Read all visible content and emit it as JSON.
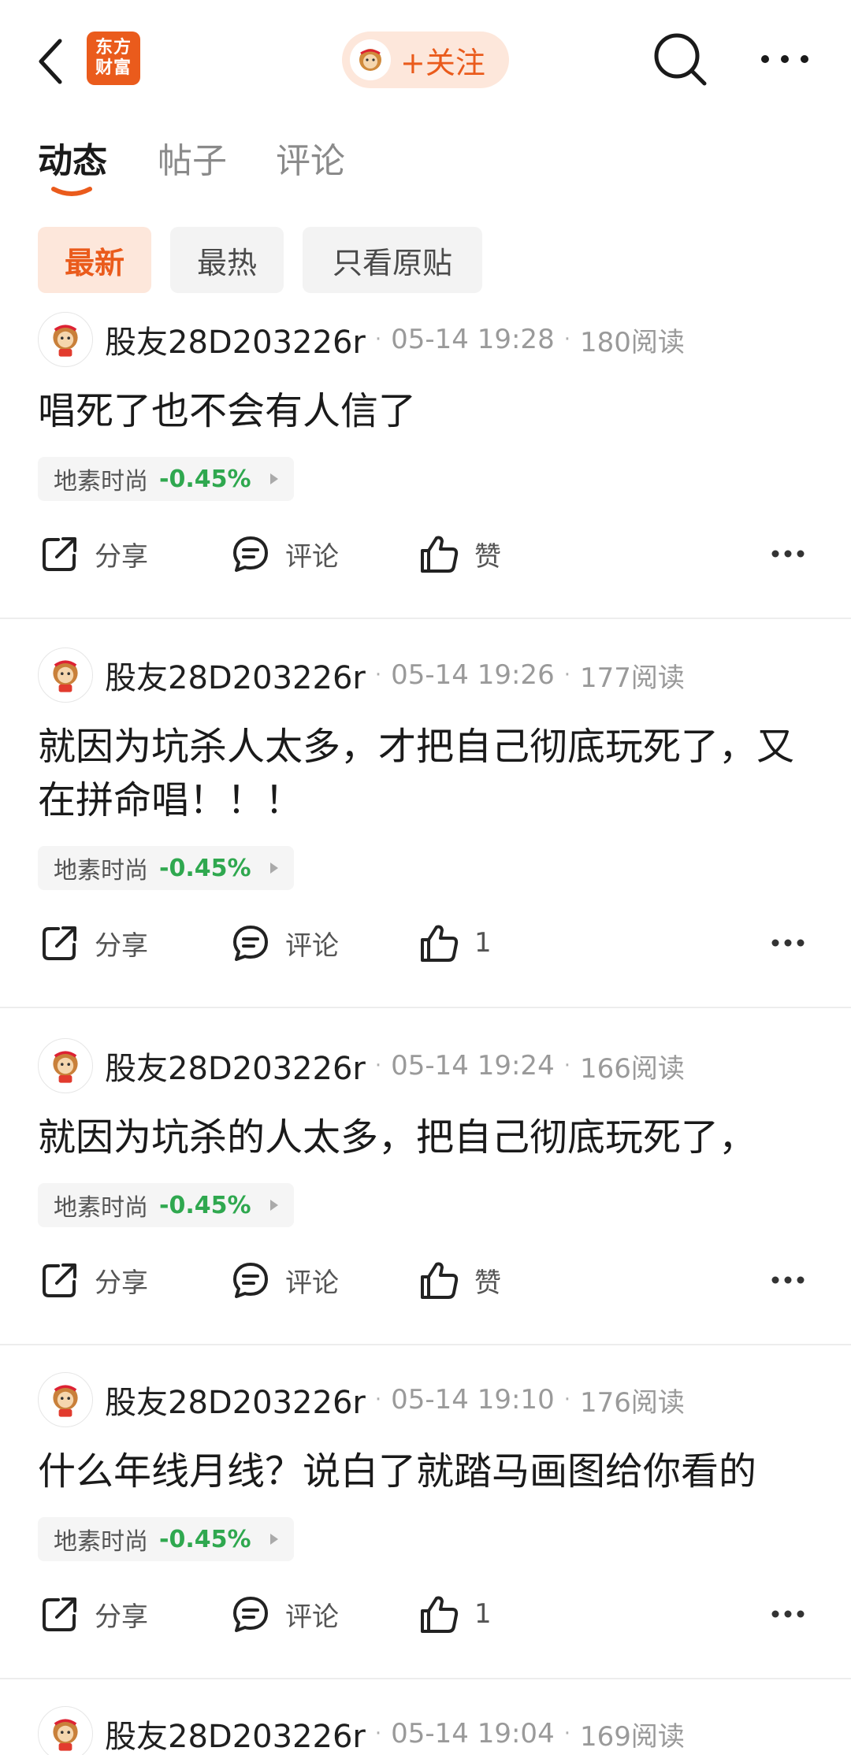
{
  "header": {
    "logo_text": "东方财富",
    "follow_label": "+关注",
    "icons": [
      "back-icon",
      "search-icon",
      "more-icon"
    ]
  },
  "tabs": [
    {
      "label": "动态",
      "active": true
    },
    {
      "label": "帖子",
      "active": false
    },
    {
      "label": "评论",
      "active": false
    }
  ],
  "filters": [
    {
      "label": "最新",
      "active": true
    },
    {
      "label": "最热",
      "active": false
    },
    {
      "label": "只看原贴",
      "active": false
    }
  ],
  "accent_color": "#ea5b1c",
  "down_color": "#2fa84f",
  "posts": [
    {
      "user": "股友28D203226r",
      "time": "05-14 19:28",
      "reads": "180阅读",
      "text": "唱死了也不会有人信了",
      "stock": "地素时尚",
      "change": "-0.45%",
      "share": "分享",
      "comment": "评论",
      "like": "赞"
    },
    {
      "user": "股友28D203226r",
      "time": "05-14 19:26",
      "reads": "177阅读",
      "text": "就因为坑杀人太多，才把自己彻底玩死了，又在拼命唱！！！",
      "stock": "地素时尚",
      "change": "-0.45%",
      "share": "分享",
      "comment": "评论",
      "like": "1"
    },
    {
      "user": "股友28D203226r",
      "time": "05-14 19:24",
      "reads": "166阅读",
      "text": "就因为坑杀的人太多，把自己彻底玩死了，",
      "stock": "地素时尚",
      "change": "-0.45%",
      "share": "分享",
      "comment": "评论",
      "like": "赞"
    },
    {
      "user": "股友28D203226r",
      "time": "05-14 19:10",
      "reads": "176阅读",
      "text": "什么年线月线？说白了就踏马画图给你看的",
      "stock": "地素时尚",
      "change": "-0.45%",
      "share": "分享",
      "comment": "评论",
      "like": "1"
    },
    {
      "user": "股友28D203226r",
      "time": "05-14 19:04",
      "reads": "169阅读"
    }
  ]
}
